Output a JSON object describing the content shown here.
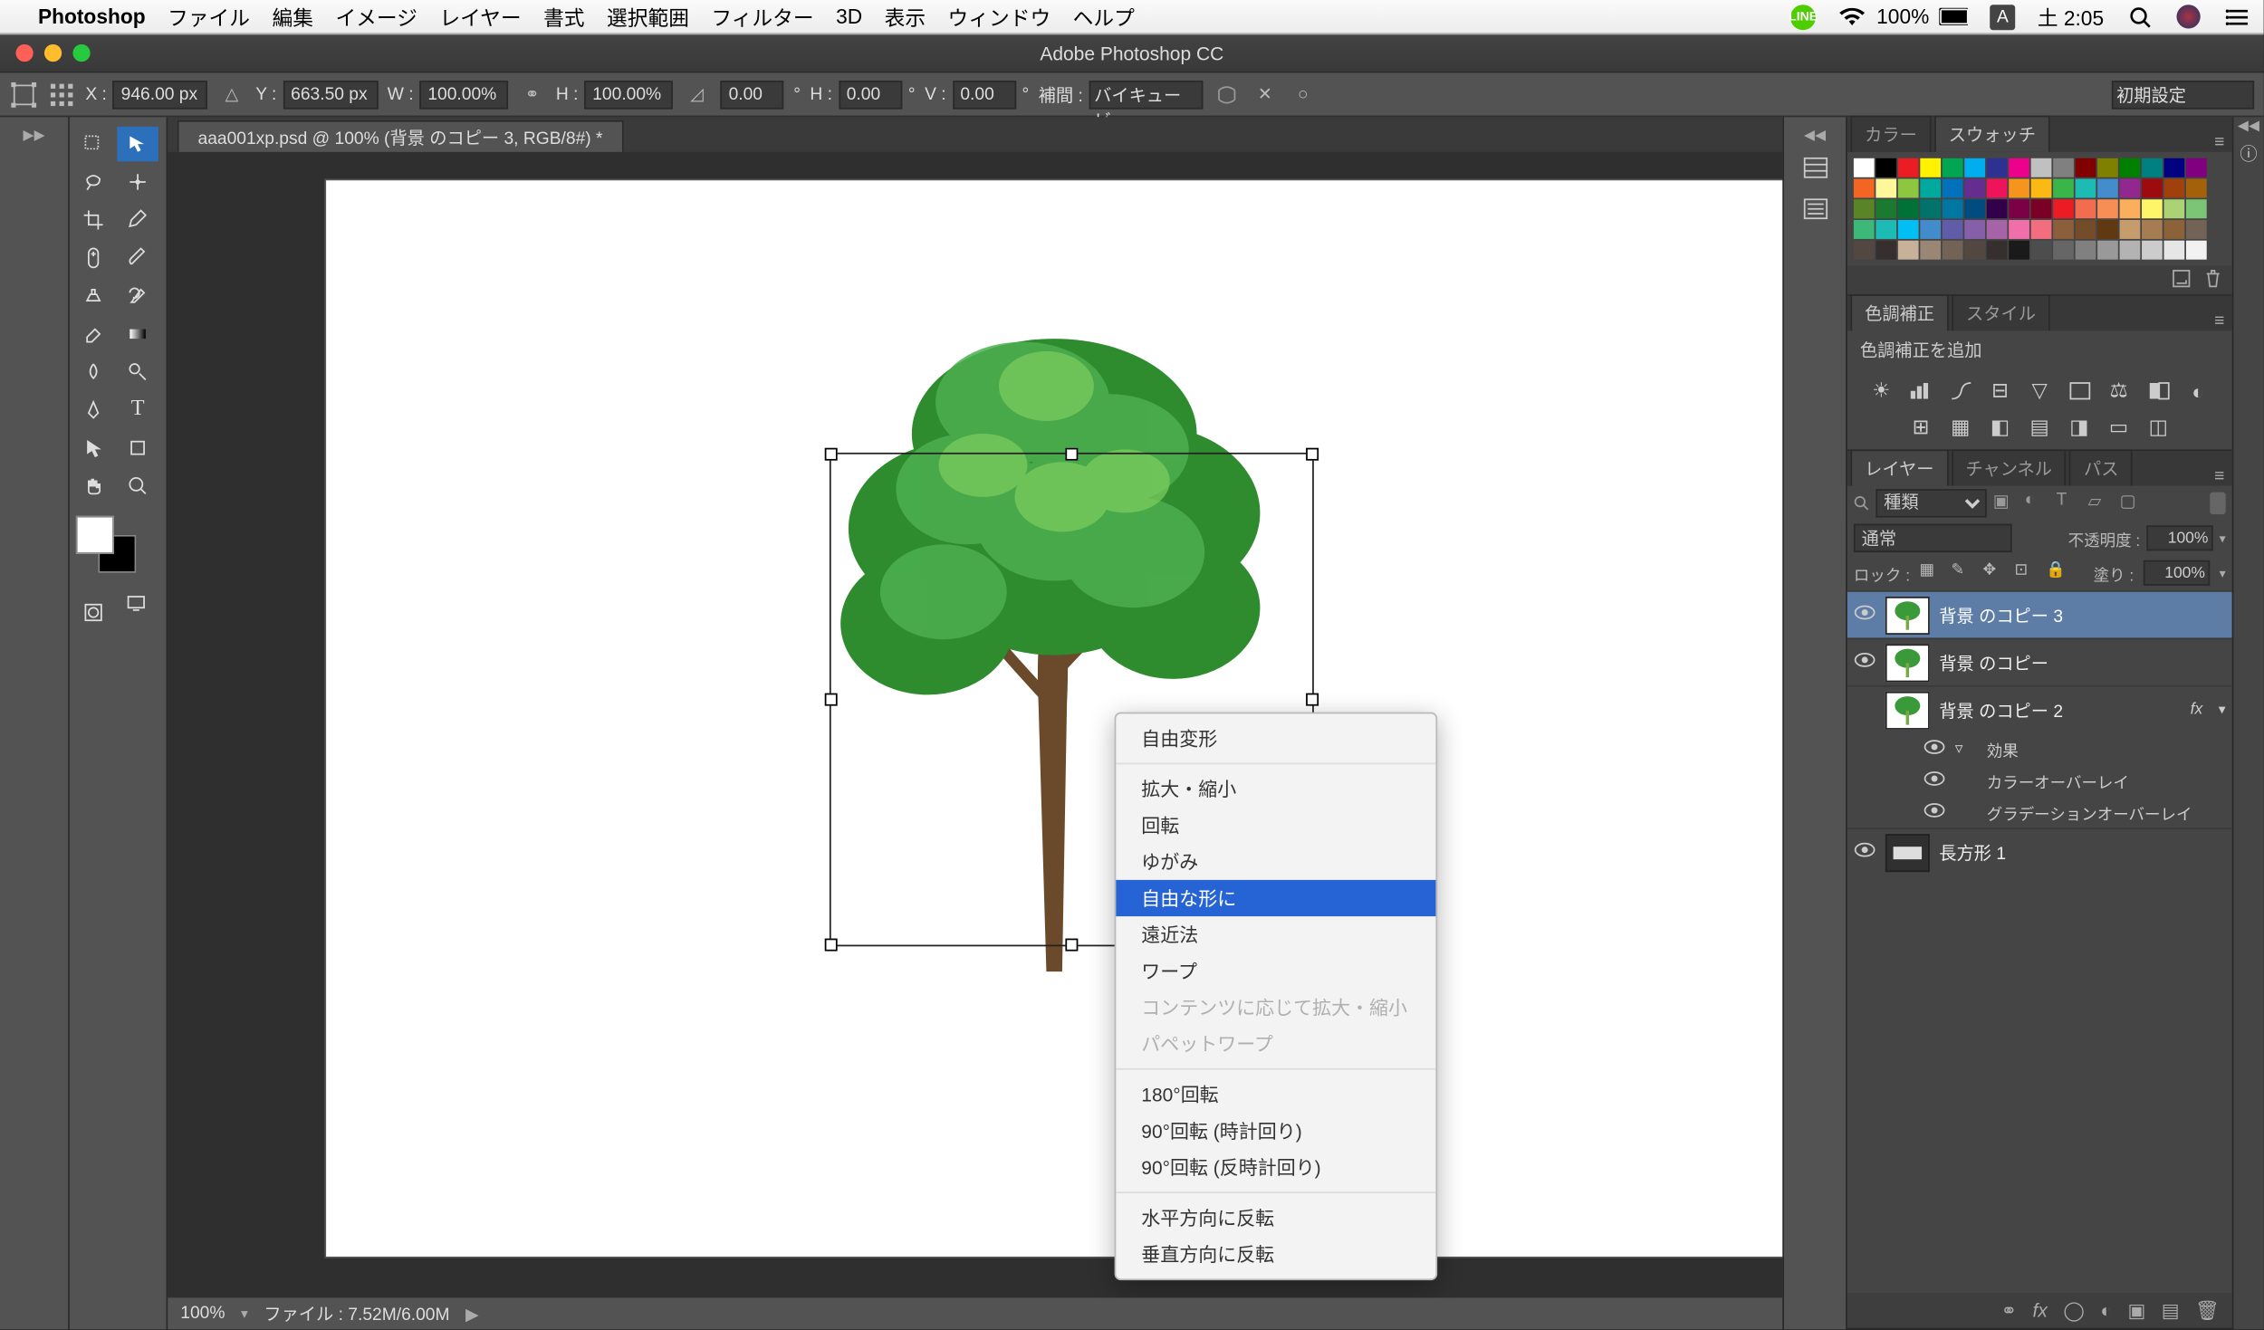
{
  "mac_menu": {
    "app": "Photoshop",
    "items": [
      "ファイル",
      "編集",
      "イメージ",
      "レイヤー",
      "書式",
      "選択範囲",
      "フィルター",
      "3D",
      "表示",
      "ウィンドウ",
      "ヘルプ"
    ],
    "right": {
      "battery": "100%",
      "ime": "A",
      "clock": "土 2:05"
    }
  },
  "window_title": "Adobe Photoshop CC",
  "options": {
    "x_label": "X :",
    "x": "946.00 px",
    "y_label": "Y :",
    "y": "663.50 px",
    "w_label": "W :",
    "w": "100.00%",
    "h_label": "H :",
    "h": "100.00%",
    "angle": "0.00",
    "angle_unit": "°",
    "shearH_label": "H :",
    "shearH": "0.00",
    "shearH_unit": "°",
    "shearV_label": "V :",
    "shearV": "0.00",
    "shearV_unit": "°",
    "interp_label": "補間 :",
    "interp": "バイキュービ…",
    "preset": "初期設定"
  },
  "doc_tab": "aaa001xp.psd @ 100% (背景 のコピー 3, RGB/8#) *",
  "context_menu": {
    "items": [
      {
        "label": "自由変形"
      },
      {
        "sep": true
      },
      {
        "label": "拡大・縮小"
      },
      {
        "label": "回転"
      },
      {
        "label": "ゆがみ"
      },
      {
        "label": "自由な形に",
        "selected": true
      },
      {
        "label": "遠近法"
      },
      {
        "label": "ワープ"
      },
      {
        "label": "コンテンツに応じて拡大・縮小",
        "disabled": true
      },
      {
        "label": "パペットワープ",
        "disabled": true
      },
      {
        "sep": true
      },
      {
        "label": "180°回転"
      },
      {
        "label": "90°回転 (時計回り)"
      },
      {
        "label": "90°回転 (反時計回り)"
      },
      {
        "sep": true
      },
      {
        "label": "水平方向に反転"
      },
      {
        "label": "垂直方向に反転"
      }
    ]
  },
  "status": {
    "zoom": "100%",
    "fileinfo": "ファイル : 7.52M/6.00M"
  },
  "panels": {
    "color_tabs": [
      "カラー",
      "スウォッチ"
    ],
    "adjustments_tabs": [
      "色調補正",
      "スタイル"
    ],
    "adj_add": "色調補正を追加",
    "layers_tabs": [
      "レイヤー",
      "チャンネル",
      "パス"
    ],
    "kind_label": "種類",
    "blend_mode": "通常",
    "opacity_label": "不透明度 :",
    "opacity": "100%",
    "lock_label": "ロック :",
    "fill_label": "塗り :",
    "fill": "100%",
    "layers": [
      {
        "name": "背景 のコピー 3",
        "selected": true,
        "visible": true,
        "thumb": "tree"
      },
      {
        "name": "背景 のコピー",
        "visible": true,
        "thumb": "tree"
      },
      {
        "name": "背景 のコピー 2",
        "visible": false,
        "thumb": "tree",
        "fx": true,
        "effects": [
          {
            "label": "効果"
          },
          {
            "label": "カラーオーバーレイ"
          },
          {
            "label": "グラデーションオーバーレイ"
          }
        ]
      },
      {
        "name": "長方形 1",
        "visible": true,
        "thumb": "shape"
      }
    ]
  },
  "swatch_colors": [
    "#ffffff",
    "#000000",
    "#ec1c24",
    "#fff200",
    "#00a651",
    "#00aeef",
    "#2e3192",
    "#ec008c",
    "#c0c0c0",
    "#808080",
    "#800000",
    "#808000",
    "#008000",
    "#008080",
    "#000080",
    "#800080",
    "#f26522",
    "#fff799",
    "#8dc63f",
    "#00a99d",
    "#0072bc",
    "#662d91",
    "#ed145b",
    "#f7941d",
    "#fdb913",
    "#39b54a",
    "#1cbbb4",
    "#448ccb",
    "#92278f",
    "#9e0b0f",
    "#a0410d",
    "#a3620a",
    "#598527",
    "#1a7b30",
    "#007236",
    "#00746b",
    "#0076a3",
    "#004b80",
    "#32004b",
    "#7b0046",
    "#7a0026",
    "#ed1c24",
    "#f26c4f",
    "#f68e56",
    "#fbaf5d",
    "#fff568",
    "#acd373",
    "#7cc576",
    "#3cb878",
    "#1cbbb4",
    "#00bff3",
    "#438ccb",
    "#605ca8",
    "#855fa8",
    "#a763a8",
    "#f06eaa",
    "#f26d7d",
    "#8b5e3c",
    "#754c29",
    "#603913",
    "#c69c6d",
    "#a67c52",
    "#8c6239",
    "#736357",
    "#534741",
    "#362f2d",
    "#c7b299",
    "#998675",
    "#736357",
    "#534741",
    "#362f2d",
    "#1a1a1a",
    "#4d4d4d",
    "#666666",
    "#808080",
    "#999999",
    "#b3b3b3",
    "#cccccc",
    "#e6e6e6",
    "#f2f2f2"
  ]
}
